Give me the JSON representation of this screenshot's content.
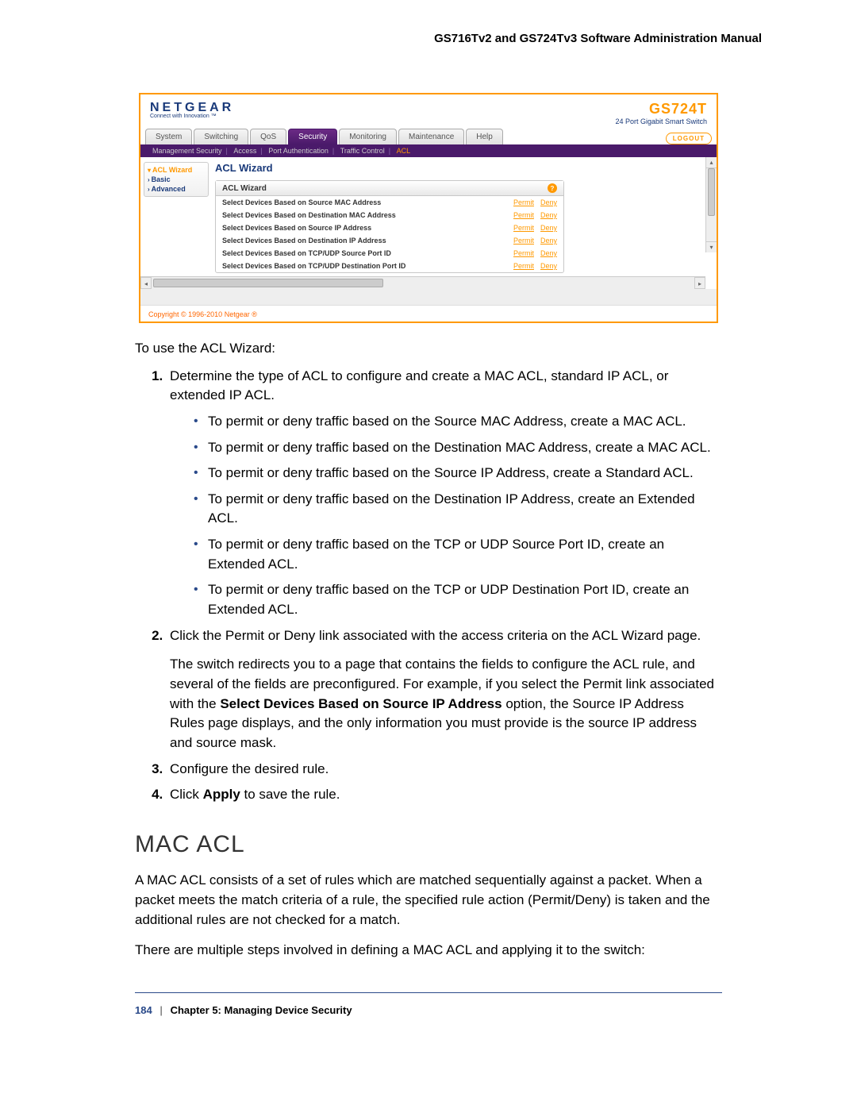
{
  "header": {
    "title": "GS716Tv2 and GS724Tv3 Software Administration Manual"
  },
  "screenshot": {
    "logo": {
      "brand": "NETGEAR",
      "tagline": "Connect with Innovation ™"
    },
    "product": {
      "code": "GS724T",
      "sub": "24 Port Gigabit Smart Switch"
    },
    "tabs": [
      "System",
      "Switching",
      "QoS",
      "Security",
      "Monitoring",
      "Maintenance",
      "Help"
    ],
    "active_tab": "Security",
    "logout": "LOGOUT",
    "subnav": {
      "items": [
        "Management Security",
        "Access",
        "Port Authentication",
        "Traffic Control",
        "ACL"
      ],
      "active": "ACL"
    },
    "sidebar": {
      "items": [
        "ACL Wizard",
        "Basic",
        "Advanced"
      ],
      "active": "ACL Wizard"
    },
    "panel": {
      "title": "ACL Wizard",
      "box_title": "ACL Wizard",
      "rows": [
        "Select Devices Based on Source MAC Address",
        "Select Devices Based on Destination MAC Address",
        "Select Devices Based on Source IP Address",
        "Select Devices Based on Destination IP Address",
        "Select Devices Based on TCP/UDP Source Port ID",
        "Select Devices Based on TCP/UDP Destination Port ID"
      ],
      "permit": "Permit",
      "deny": "Deny"
    },
    "copyright": "Copyright © 1996-2010 Netgear ®"
  },
  "doc": {
    "intro": "To use the ACL Wizard:",
    "step1": "Determine the type of ACL to configure and create a MAC ACL, standard IP ACL, or extended IP ACL.",
    "bullets": [
      "To permit or deny traffic based on the Source MAC Address, create a MAC ACL.",
      "To permit or deny traffic based on the Destination MAC Address, create a MAC ACL.",
      "To permit or deny traffic based on the Source IP Address, create a Standard ACL.",
      "To permit or deny traffic based on the Destination IP Address, create an Extended ACL.",
      "To permit or deny traffic based on the TCP or UDP Source Port ID, create an Extended ACL.",
      "To permit or deny traffic based on the TCP or UDP Destination Port ID, create an Extended ACL."
    ],
    "step2": "Click the Permit or Deny link associated with the access criteria on the ACL Wizard page.",
    "step2_para_pre": "The switch redirects you to a page that contains the fields to configure the ACL rule, and several of the fields are preconfigured. For example, if you select the Permit link associated with the ",
    "step2_bold": "Select Devices Based on Source IP Address",
    "step2_para_post": " option, the Source IP Address Rules page displays, and the only information you must provide is the source IP address and source mask.",
    "step3": "Configure the desired rule.",
    "step4_pre": "Click ",
    "step4_bold": "Apply",
    "step4_post": " to save the rule.",
    "section_heading": "MAC ACL",
    "macacl_p1": "A MAC ACL consists of a set of rules which are matched sequentially against a packet. When a packet meets the match criteria of a rule, the specified rule action (Permit/Deny) is taken and the additional rules are not checked for a match.",
    "macacl_p2": "There are multiple steps involved in defining a MAC ACL and applying it to the switch:"
  },
  "footer": {
    "page": "184",
    "chapter": "Chapter 5:  Managing Device Security"
  }
}
